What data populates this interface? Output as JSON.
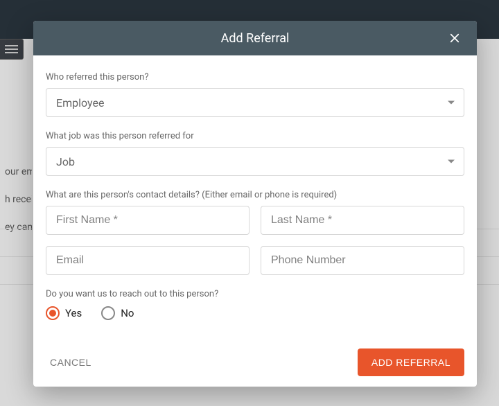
{
  "background": {
    "snippet_line1": "our em",
    "snippet_line2": "h recei",
    "snippet_line3": "ey can "
  },
  "modal": {
    "title": "Add Referral",
    "sections": {
      "who_label": "Who referred this person?",
      "who_value": "Employee",
      "job_label": "What job was this person referred for",
      "job_value": "Job",
      "contact_label": "What are this person's contact details? (Either email or phone is required)",
      "first_name_placeholder": "First Name *",
      "last_name_placeholder": "Last Name *",
      "email_placeholder": "Email",
      "phone_placeholder": "Phone Number",
      "reach_out_label": "Do you want us to reach out to this person?",
      "radio_yes": "Yes",
      "radio_no": "No",
      "radio_selected": "yes"
    },
    "footer": {
      "cancel": "CANCEL",
      "submit": "ADD REFERRAL"
    }
  },
  "colors": {
    "accent": "#e8552b",
    "header": "#4a5a63"
  }
}
